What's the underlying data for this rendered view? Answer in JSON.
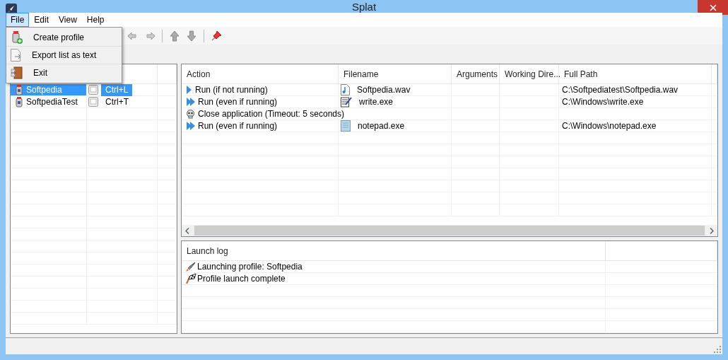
{
  "window": {
    "title": "Splat"
  },
  "menu": [
    {
      "label": "File",
      "selected": true
    },
    {
      "label": "Edit",
      "selected": false
    },
    {
      "label": "View",
      "selected": false
    },
    {
      "label": "Help",
      "selected": false
    }
  ],
  "file_menu": [
    {
      "label": "Create profile",
      "kind": "create"
    },
    {
      "label": "Export list as text",
      "kind": "export"
    },
    {
      "label": "Exit",
      "kind": "exit"
    }
  ],
  "profiles": [
    {
      "name": "Softpedia",
      "shortcut": "Ctrl+L",
      "selected": true
    },
    {
      "name": "SoftpediaTest",
      "shortcut": "Ctrl+T",
      "selected": false
    }
  ],
  "actions": {
    "columns": [
      "Action",
      "Filename",
      "Arguments",
      "Working Dire...",
      "Full Path"
    ],
    "rows": [
      {
        "kind": "run_once",
        "action": "Run (if not running)",
        "file": {
          "kind": "audio",
          "name": "Softpedia.wav"
        },
        "full_path": "C:\\Softpediatest\\Softpedia.wav"
      },
      {
        "kind": "run",
        "action": "Run (even if running)",
        "file": {
          "kind": "write",
          "name": "write.exe"
        },
        "full_path": "C:\\Windows\\write.exe"
      },
      {
        "kind": "close",
        "action": "Close application (Timeout: 5 seconds)"
      },
      {
        "kind": "run",
        "action": "Run (even if running)",
        "file": {
          "kind": "notepad",
          "name": "notepad.exe"
        },
        "full_path": "C:\\Windows\\notepad.exe"
      }
    ]
  },
  "log": {
    "title": "Launch log",
    "entries": [
      {
        "kind": "launch",
        "text": "Launching profile: Softpedia"
      },
      {
        "kind": "complete",
        "text": "Profile launch complete"
      }
    ]
  }
}
